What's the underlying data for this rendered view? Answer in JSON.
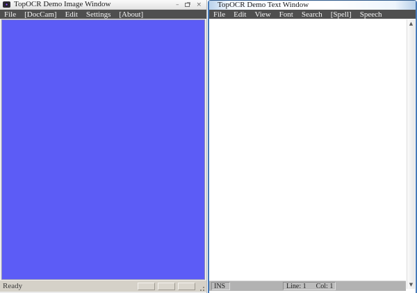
{
  "image_window": {
    "title": "TopOCR Demo Image Window",
    "icon": "camera-icon",
    "controls": {
      "minimize_glyph": "–",
      "close_glyph": "×"
    },
    "menu": [
      "File",
      "[DocCam]",
      "Edit",
      "Settings",
      "[About]"
    ],
    "status": {
      "message": "Ready",
      "empty_pane_count": 3
    },
    "canvas_color": "#5c5cf6"
  },
  "text_window": {
    "title": "TopOCR Demo Text Window",
    "menu": [
      "File",
      "Edit",
      "View",
      "Font",
      "Search",
      "[Spell]",
      "Speech"
    ],
    "status": {
      "insert_mode": "INS",
      "line": "Line: 1",
      "col": "Col: 1"
    },
    "scrollbar": {
      "up_glyph": "▲",
      "down_glyph": "▼"
    },
    "border_color": "#4579b8"
  },
  "colors": {
    "menu_bar": "#4f4f4f",
    "canvas_blue": "#5c5cf6",
    "status_gray_right": "#b2b2b2",
    "status_gray_left": "#d5d1c8"
  }
}
